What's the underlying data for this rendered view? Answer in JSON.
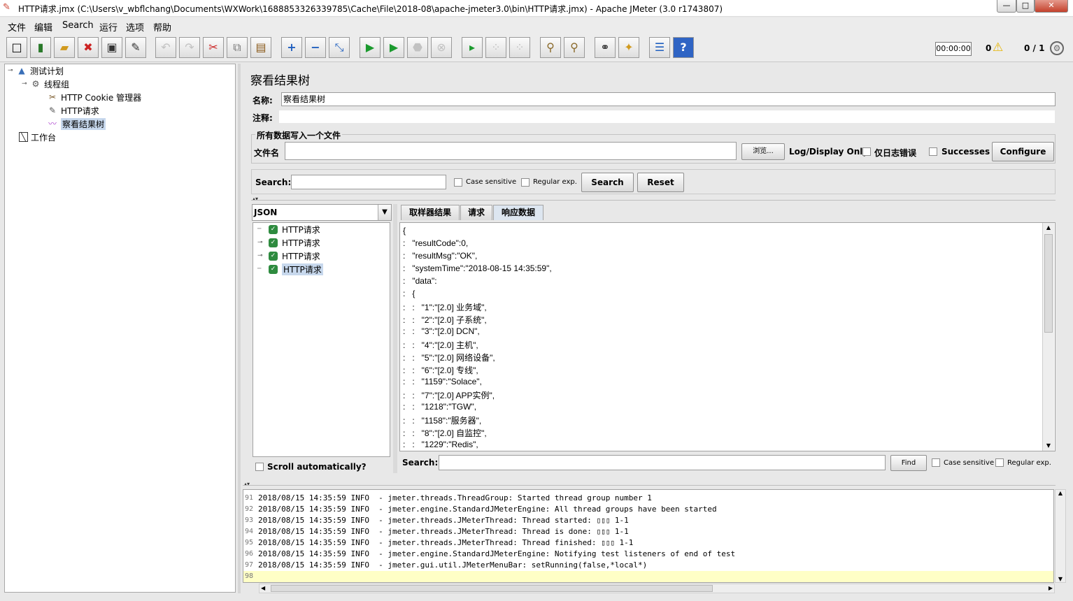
{
  "window": {
    "title": "HTTP请求.jmx (C:\\Users\\v_wbflchang\\Documents\\WXWork\\1688853326339785\\Cache\\File\\2018-08\\apache-jmeter3.0\\bin\\HTTP请求.jmx) - Apache JMeter (3.0 r1743807)",
    "minimize": "—",
    "maximize": "□",
    "close": "✕"
  },
  "menu": [
    "文件",
    "编辑",
    "Search",
    "运行",
    "选项",
    "帮助"
  ],
  "toolbar": {
    "icons": [
      "new-icon",
      "templates-icon",
      "open-icon",
      "close-file-icon",
      "save-icon",
      "save-as-icon",
      "undo-icon",
      "redo-icon",
      "cut-icon",
      "copy-icon",
      "paste-icon",
      "expand-icon",
      "collapse-icon",
      "toggle-icon",
      "start-icon",
      "start-no-pause-icon",
      "stop-icon",
      "shutdown-icon",
      "remote-start-icon",
      "remote-stop-icon",
      "remote-shutdown-icon",
      "clear-icon",
      "clear-all-icon",
      "search-icon",
      "reset-search-icon",
      "function-helper-icon",
      "help-icon"
    ],
    "timer": "00:00:00",
    "warnings": "0",
    "threads": "0 / 1"
  },
  "tree": {
    "items": [
      {
        "label": "测试计划",
        "icon": "test-plan-icon"
      },
      {
        "label": "线程组",
        "icon": "thread-group-icon"
      },
      {
        "label": "HTTP Cookie 管理器",
        "icon": "cookie-manager-icon"
      },
      {
        "label": "HTTP请求",
        "icon": "sampler-icon"
      },
      {
        "label": "察看结果树",
        "icon": "listener-icon"
      },
      {
        "label": "工作台",
        "icon": "workbench-icon"
      }
    ]
  },
  "panel": {
    "title": "察看结果树",
    "name_label": "名称:",
    "name_value": "察看结果树",
    "comment_label": "注释:",
    "file_section": "所有数据写入一个文件",
    "file_label": "文件名",
    "browse": "浏览...",
    "log_display": "Log/Display Only:",
    "errors_only": "仅日志错误",
    "successes": "Successes",
    "configure": "Configure",
    "search_label": "Search:",
    "case_sensitive": "Case sensitive",
    "regular_exp": "Regular exp.",
    "search_btn": "Search",
    "reset_btn": "Reset"
  },
  "results": {
    "renderer": "JSON",
    "items": [
      "HTTP请求",
      "HTTP请求",
      "HTTP请求",
      "HTTP请求"
    ],
    "scroll_auto": "Scroll automatically?"
  },
  "tabs": [
    "取样器结果",
    "请求",
    "响应数据"
  ],
  "response": {
    "lines": [
      "{",
      ":   \"resultCode\":0,",
      ":   \"resultMsg\":\"OK\",",
      ":   \"systemTime\":\"2018-08-15 14:35:59\",",
      ":   \"data\":",
      ":   {",
      ":   :   \"1\":\"[2.0] 业务域\",",
      ":   :   \"2\":\"[2.0] 子系统\",",
      ":   :   \"3\":\"[2.0] DCN\",",
      ":   :   \"4\":\"[2.0] 主机\",",
      ":   :   \"5\":\"[2.0] 网络设备\",",
      ":   :   \"6\":\"[2.0] 专线\",",
      ":   :   \"1159\":\"Solace\",",
      ":   :   \"7\":\"[2.0] APP实例\",",
      ":   :   \"1218\":\"TGW\",",
      ":   :   \"1158\":\"服务器\",",
      ":   :   \"8\":\"[2.0] 自监控\",",
      ":   :   \"1229\":\"Redis\","
    ],
    "search_label": "Search:",
    "find": "Find",
    "case_sensitive": "Case sensitive",
    "regular_exp": "Regular exp."
  },
  "log": {
    "lines": [
      {
        "n": "91",
        "t": "2018/08/15 14:35:59 INFO  - jmeter.threads.ThreadGroup: Started thread group number 1"
      },
      {
        "n": "92",
        "t": "2018/08/15 14:35:59 INFO  - jmeter.engine.StandardJMeterEngine: All thread groups have been started"
      },
      {
        "n": "93",
        "t": "2018/08/15 14:35:59 INFO  - jmeter.threads.JMeterThread: Thread started: ▯▯▯ 1-1"
      },
      {
        "n": "94",
        "t": "2018/08/15 14:35:59 INFO  - jmeter.threads.JMeterThread: Thread is done: ▯▯▯ 1-1"
      },
      {
        "n": "95",
        "t": "2018/08/15 14:35:59 INFO  - jmeter.threads.JMeterThread: Thread finished: ▯▯▯ 1-1"
      },
      {
        "n": "96",
        "t": "2018/08/15 14:35:59 INFO  - jmeter.engine.StandardJMeterEngine: Notifying test listeners of end of test"
      },
      {
        "n": "97",
        "t": "2018/08/15 14:35:59 INFO  - jmeter.gui.util.JMeterMenuBar: setRunning(false,*local*)"
      },
      {
        "n": "98",
        "t": ""
      }
    ]
  }
}
